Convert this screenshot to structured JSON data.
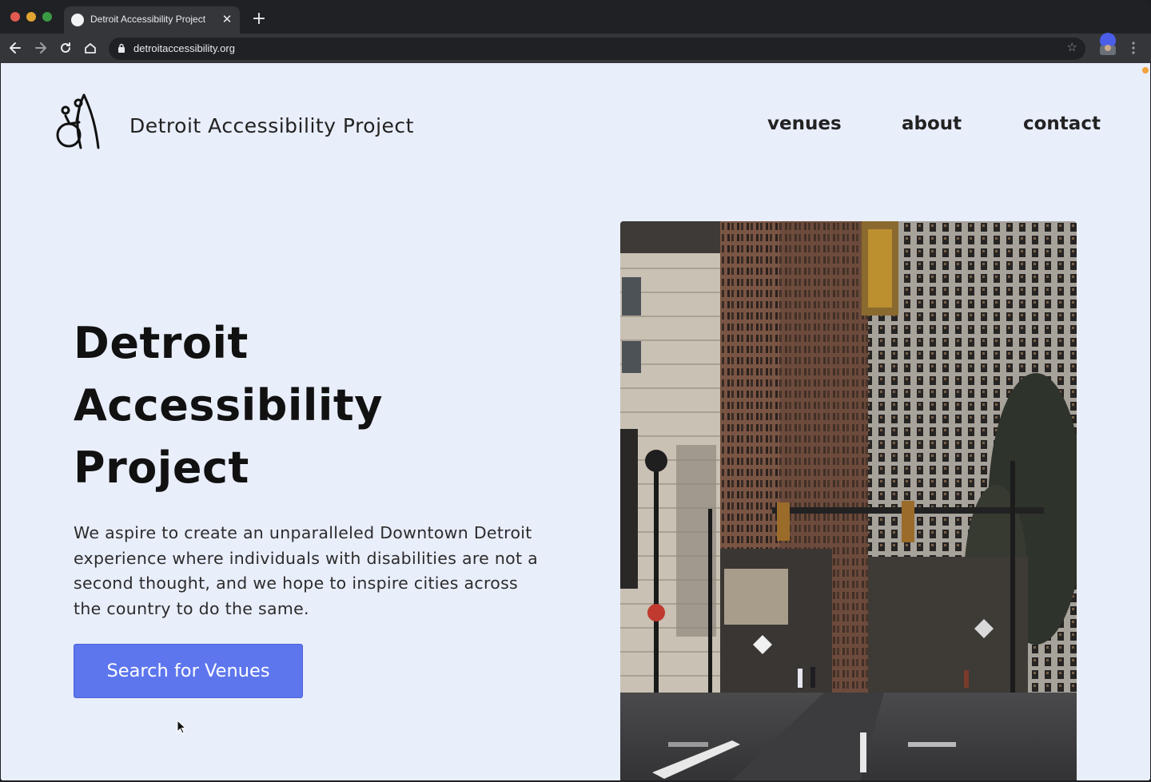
{
  "browser": {
    "tab_title": "Detroit Accessibility Project",
    "url": "detroitaccessibility.org",
    "icons": {
      "back": "arrow-left-icon",
      "forward": "arrow-right-icon",
      "reload": "reload-icon",
      "home": "home-icon",
      "lock": "lock-icon",
      "bookmark": "star-icon",
      "menu": "kebab-menu-icon",
      "new_tab": "plus-icon",
      "close_tab": "close-icon"
    },
    "colors": {
      "frame": "#202124",
      "toolbar": "#35363a"
    }
  },
  "site": {
    "brand": "Detroit Accessibility Project",
    "nav": {
      "venues": "venues",
      "about": "about",
      "contact": "contact"
    },
    "hero": {
      "title_lines": [
        "Detroit",
        "Accessibility",
        "Project"
      ],
      "description": "We aspire to create an unparalleled Downtown Detroit experience where individuals with disabilities are not a second thought, and we hope to inspire cities across the country to do the same.",
      "cta_label": "Search for Venues"
    },
    "colors": {
      "background": "#e9eefb",
      "button": "#5d76ee",
      "text": "#222222"
    }
  }
}
